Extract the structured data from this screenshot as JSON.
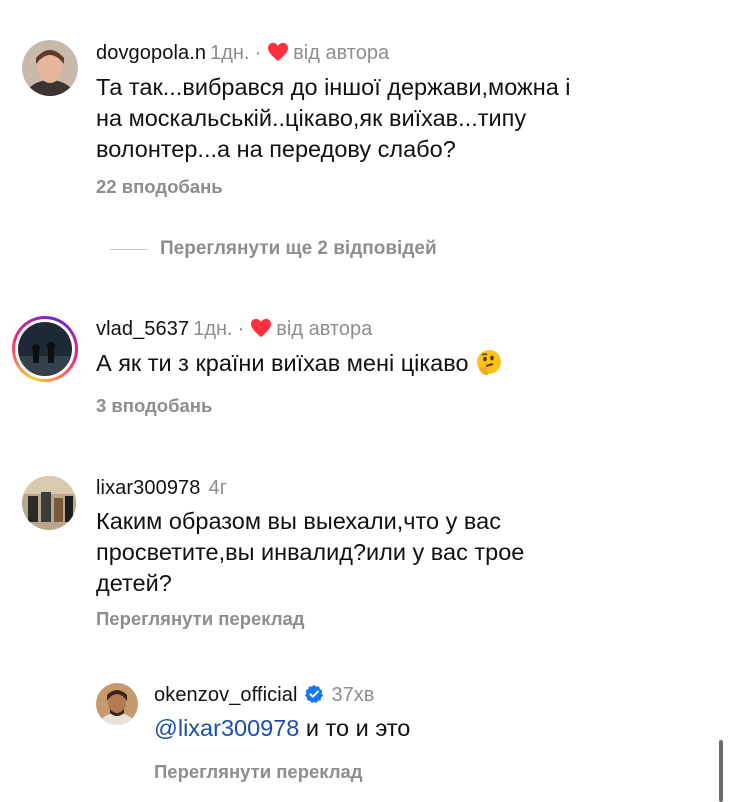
{
  "comments": [
    {
      "username": "dovgopola.n",
      "time": "1дн.",
      "dot": "·",
      "liked_label": "від автора",
      "text_lines": [
        "Та так...вибрався до іншої держави,можна і",
        "на москальській..цікаво,як виїхав...типу",
        "волонтер...а на передову слабо?"
      ],
      "likes": "22 вподобань"
    },
    {
      "username": "vlad_5637",
      "time": "1дн.",
      "dot": "·",
      "liked_label": "від автора",
      "text": "А як ти з країни виїхав мені цікаво",
      "likes": "3 вподобань"
    },
    {
      "username": "lixar300978",
      "time": "4г",
      "text_lines": [
        "Каким образом вы выехали,что у вас",
        "просветите,вы инвалид?или у вас трое",
        "детей?"
      ],
      "translate": "Переглянути переклад"
    },
    {
      "username": "okenzov_official",
      "time": "37хв",
      "mention": "@lixar300978",
      "text": " и то и это",
      "translate": "Переглянути переклад"
    }
  ],
  "view_replies": "Переглянути ще 2 відповідей",
  "colors": {
    "heart": "#ff3040",
    "verified": "#1877f2",
    "mention": "#1c4ea8",
    "muted": "#8e8e8e"
  },
  "icons": [
    "heart-icon",
    "verified-badge-icon",
    "thinking-face-emoji"
  ]
}
